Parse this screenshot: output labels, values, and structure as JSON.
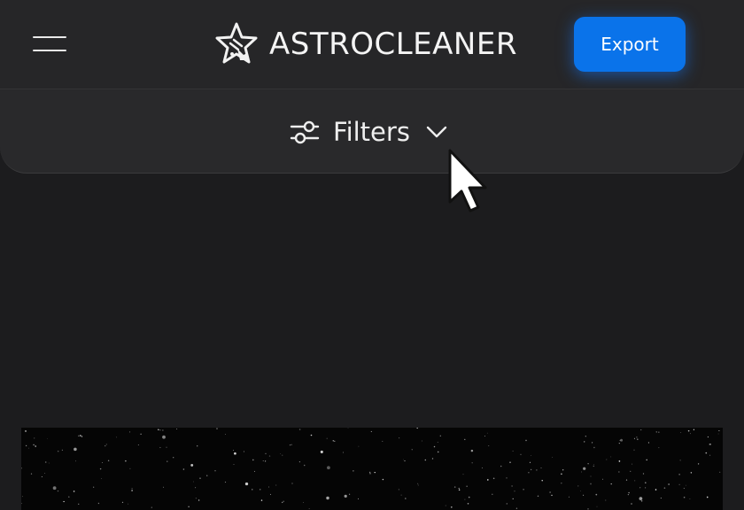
{
  "header": {
    "menu_icon": "hamburger-menu-icon",
    "logo_icon": "star-broom-logo-icon",
    "app_name": "ASTROCLEANER",
    "export_label": "Export"
  },
  "filters": {
    "icon": "sliders-icon",
    "label": "Filters",
    "chevron_icon": "chevron-down-icon",
    "expanded": false
  },
  "preview": {
    "content": "starfield-image"
  },
  "cursor": {
    "icon": "mouse-pointer-icon"
  },
  "colors": {
    "background": "#1c1c1e",
    "header": "#262628",
    "panel": "#29292b",
    "accent": "#0a73ea",
    "text": "#eeeeee"
  }
}
